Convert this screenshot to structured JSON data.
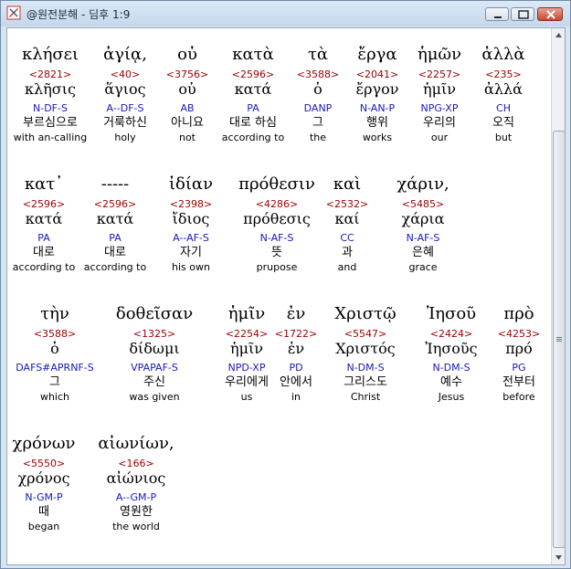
{
  "window": {
    "title": "@원전분해 - 딤후 1:9"
  },
  "rows": [
    [
      {
        "g": "κλήσει",
        "num": "<2821>",
        "lemma": "κλῆσις",
        "code": "N-DF-S",
        "kor": "부르심으로",
        "eng": "with an-calling"
      },
      {
        "g": "ἁγίᾳ,",
        "num": "<40>",
        "lemma": "ἅγιος",
        "code": "A--DF-S",
        "kor": "거룩하신",
        "eng": "holy"
      },
      {
        "g": "οὐ",
        "num": "<3756>",
        "lemma": "οὐ",
        "code": "AB",
        "kor": "아니요",
        "eng": "not"
      },
      {
        "g": "κατὰ",
        "num": "<2596>",
        "lemma": "κατά",
        "code": "PA",
        "kor": "대로 하심",
        "eng": "according to"
      },
      {
        "g": "τὰ",
        "num": "<3588>",
        "lemma": "ὁ",
        "code": "DANP",
        "kor": "그",
        "eng": "the"
      },
      {
        "g": "ἔργα",
        "num": "<2041>",
        "lemma": "ἔργον",
        "code": "N-AN-P",
        "kor": "행위",
        "eng": "works"
      },
      {
        "g": "ἡμῶν",
        "num": "<2257>",
        "lemma": "ἡμῖν",
        "code": "NPG-XP",
        "kor": "우리의",
        "eng": "our"
      },
      {
        "g": "ἀλλὰ",
        "num": "<235>",
        "lemma": "ἀλλά",
        "code": "CH",
        "kor": "오직",
        "eng": "but"
      }
    ],
    [
      {
        "g": "κατ᾽",
        "num": "<2596>",
        "lemma": "κατά",
        "code": "PA",
        "kor": "대로",
        "eng": "according to"
      },
      {
        "g": "-----",
        "num": "<2596>",
        "lemma": "κατά",
        "code": "PA",
        "kor": "대로",
        "eng": "according to"
      },
      {
        "g": "ἰδίαν",
        "num": "<2398>",
        "lemma": "ἴδιος",
        "code": "A--AF-S",
        "kor": "자기",
        "eng": "his own"
      },
      {
        "g": "πρόθεσιν",
        "num": "<4286>",
        "lemma": "πρόθεσις",
        "code": "N-AF-S",
        "kor": "뜻",
        "eng": "prupose"
      },
      {
        "g": "καὶ",
        "num": "<2532>",
        "lemma": "καί",
        "code": "CC",
        "kor": "과",
        "eng": "and"
      },
      {
        "g": "χάριν,",
        "num": "<5485>",
        "lemma": "χάρια",
        "code": "N-AF-S",
        "kor": "은혜",
        "eng": "grace"
      }
    ],
    [
      {
        "g": "τὴν",
        "num": "<3588>",
        "lemma": "ὁ",
        "code": "DAFS#APRNF-S",
        "kor": "그",
        "eng": "which"
      },
      {
        "g": "δοθεῖσαν",
        "num": "<1325>",
        "lemma": "δίδωμι",
        "code": "VPAPAF-S",
        "kor": "주신",
        "eng": "was given"
      },
      {
        "g": "ἡμῖν",
        "num": "<2254>",
        "lemma": "ἡμῖν",
        "code": "NPD-XP",
        "kor": "우리에게",
        "eng": "us"
      },
      {
        "g": "ἐν",
        "num": "<1722>",
        "lemma": "ἐν",
        "code": "PD",
        "kor": "안에서",
        "eng": "in"
      },
      {
        "g": "Χριστῷ",
        "num": "<5547>",
        "lemma": "Χριστός",
        "code": "N-DM-S",
        "kor": "그리스도",
        "eng": "Christ"
      },
      {
        "g": "Ἰησοῦ",
        "num": "<2424>",
        "lemma": "Ἰησοῦς",
        "code": "N-DM-S",
        "kor": "예수",
        "eng": "Jesus"
      },
      {
        "g": "πρὸ",
        "num": "<4253>",
        "lemma": "πρό",
        "code": "PG",
        "kor": "전부터",
        "eng": "before"
      }
    ],
    [
      {
        "g": "χρόνων",
        "num": "<5550>",
        "lemma": "χρόνος",
        "code": "N-GM-P",
        "kor": "때",
        "eng": "began"
      },
      {
        "g": "αἰωνίων,",
        "num": "<166>",
        "lemma": "αἰώνιος",
        "code": "A--GM-P",
        "kor": "영원한",
        "eng": "the world"
      }
    ]
  ]
}
